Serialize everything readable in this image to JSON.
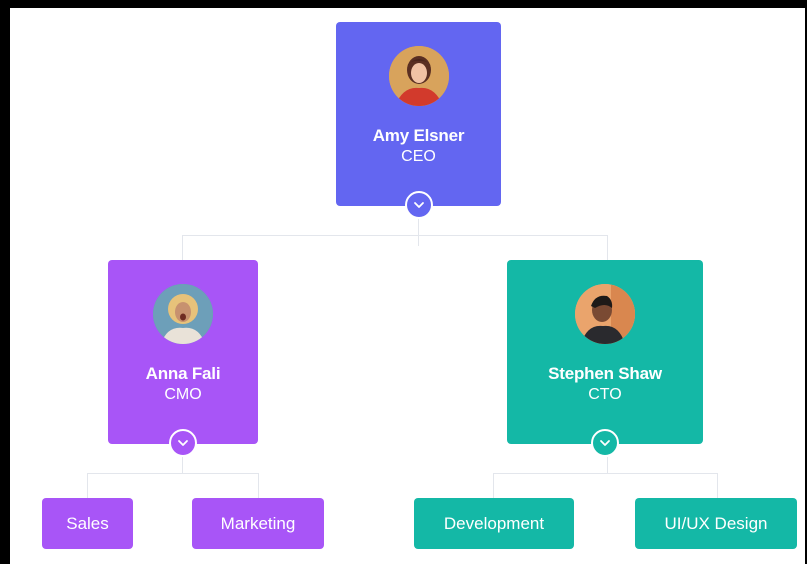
{
  "colors": {
    "ceo": "#6366f1",
    "cmo": "#a855f7",
    "cto": "#14b8a6",
    "connector": "#e3e6ec"
  },
  "nodes": {
    "ceo": {
      "name": "Amy Elsner",
      "title": "CEO",
      "avatar_icon": "avatar-photo-icon",
      "toggle_icon": "chevron-down-icon"
    },
    "cmo": {
      "name": "Anna Fali",
      "title": "CMO",
      "avatar_icon": "avatar-photo-icon",
      "toggle_icon": "chevron-down-icon"
    },
    "cto": {
      "name": "Stephen Shaw",
      "title": "CTO",
      "avatar_icon": "avatar-photo-icon",
      "toggle_icon": "chevron-down-icon"
    }
  },
  "leaves": {
    "sales": "Sales",
    "marketing": "Marketing",
    "development": "Development",
    "uiux": "UI/UX Design"
  }
}
